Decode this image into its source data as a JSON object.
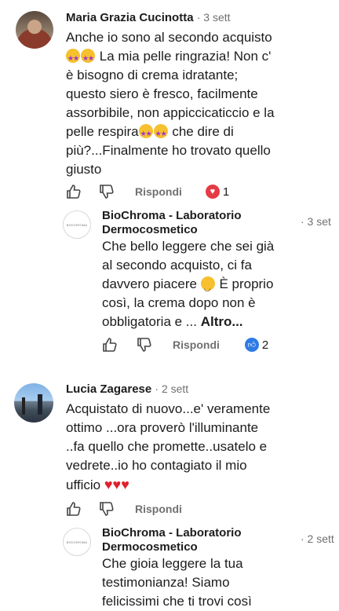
{
  "comments": [
    {
      "author": "Maria Grazia Cucinotta",
      "date": "· 3 sett",
      "lines": [
        "Anche io sono al secondo acquisto",
        "La mia pelle ringrazia! Non c'",
        "è bisogno di crema idratante;",
        "questo siero è fresco, facilmente",
        "assorbibile, non appiccicaticcio e la",
        "pelle respira",
        "che dire di",
        "più?...Finalmente ho trovato quello",
        "giusto"
      ],
      "reply_label": "Rispondi",
      "reaction_count": "1",
      "reply": {
        "author_line1": "BioChroma - Laboratorio",
        "author_line2": "Dermocosmetico",
        "date": "· 3 set",
        "lines": [
          "Che bello leggere che sei già",
          "al secondo acquisto, ci fa",
          "davvero piacere",
          "È proprio",
          "così, la crema dopo non è",
          "obbligatoria e ..."
        ],
        "more": "Altro...",
        "reply_label": "Rispondi",
        "reaction_count": "2"
      }
    },
    {
      "author": "Lucia Zagarese",
      "date": "· 2 sett",
      "lines": [
        "Acquistato di nuovo...e' veramente",
        "ottimo ...ora proverò l'illuminante",
        "..fa quello che promette..usatelo e",
        "vedrete..io ho contagiato il mio",
        "ufficio"
      ],
      "reply_label": "Rispondi",
      "reply": {
        "author_line1": "BioChroma - Laboratorio",
        "author_line2": "Dermocosmetico",
        "date": "· 2 sett",
        "lines": [
          "Che gioia leggere la tua",
          "testimonianza! Siamo",
          "felicissimi che ti trovi così"
        ]
      }
    }
  ],
  "brand_avatar_text": "BIOCHROMA",
  "icons": [
    "thumbs-up-icon",
    "thumbs-down-icon",
    "heart-reaction-icon",
    "like-reaction-icon",
    "star-struck-emoji",
    "smiling-emoji",
    "red-heart-emoji"
  ]
}
